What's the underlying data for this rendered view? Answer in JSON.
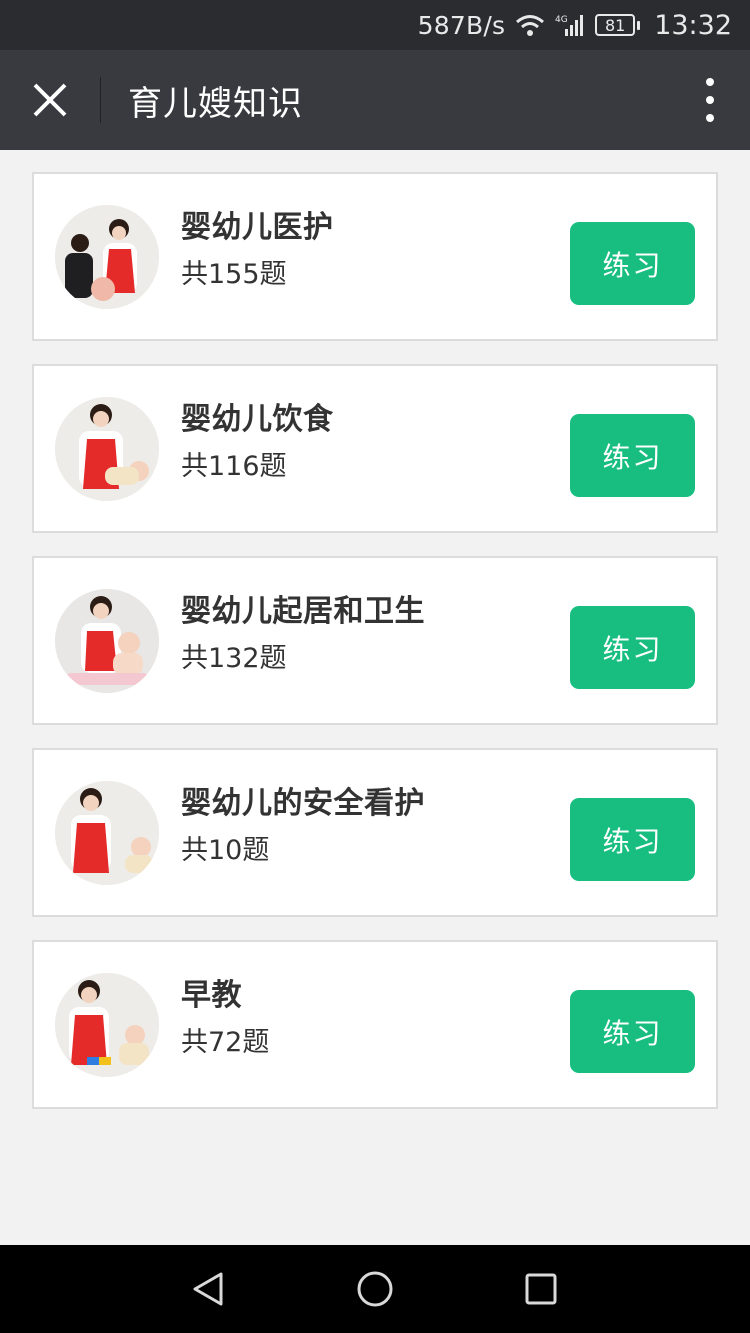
{
  "status_bar": {
    "network_speed": "587B/s",
    "network_type": "4G",
    "battery": "81",
    "time": "13:32",
    "icons": [
      "wifi-icon",
      "signal-icon",
      "battery-icon"
    ]
  },
  "header": {
    "title": "育儿嫂知识",
    "close_icon": "close-icon",
    "more_icon": "more-vertical-icon"
  },
  "courses": [
    {
      "title": "婴幼儿医护",
      "count": "共155题",
      "button": "练习",
      "avatar": "caregiver-with-doll-photo"
    },
    {
      "title": "婴幼儿饮食",
      "count": "共116题",
      "button": "练习",
      "avatar": "caregiver-feeding-baby-photo"
    },
    {
      "title": "婴幼儿起居和卫生",
      "count": "共132题",
      "button": "练习",
      "avatar": "caregiver-bathing-baby-photo"
    },
    {
      "title": "婴幼儿的安全看护",
      "count": "共10题",
      "button": "练习",
      "avatar": "caregiver-watching-baby-photo"
    },
    {
      "title": "早教",
      "count": "共72题",
      "button": "练习",
      "avatar": "caregiver-playing-with-baby-photo"
    }
  ],
  "nav_bar": {
    "icons": [
      "back-icon",
      "home-icon",
      "recent-apps-icon"
    ]
  },
  "colors": {
    "status_bar_bg": "#2b2c30",
    "title_bar_bg": "#393a3f",
    "page_bg": "#f2f2f2",
    "accent_green": "#17be7f",
    "apron_red": "#e52a2a"
  }
}
